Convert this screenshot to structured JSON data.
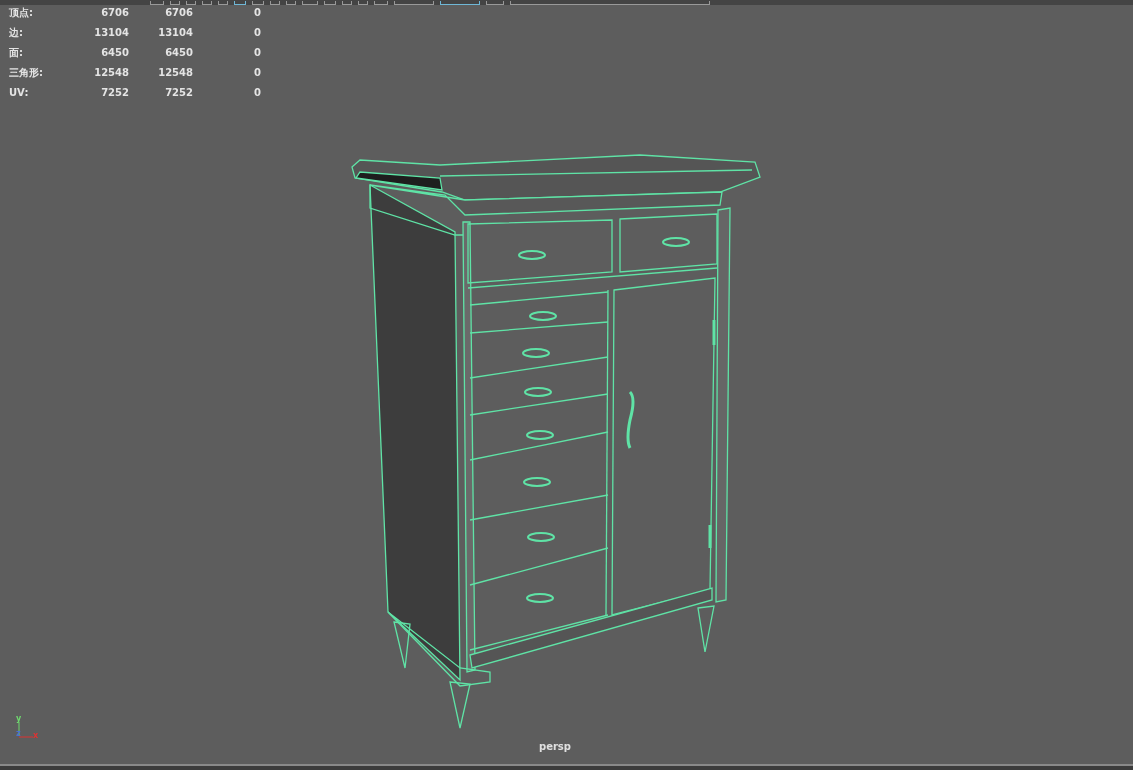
{
  "stats": [
    {
      "label": "顶点:",
      "values": [
        "6706",
        "6706",
        "0"
      ]
    },
    {
      "label": "边:",
      "values": [
        "13104",
        "13104",
        "0"
      ]
    },
    {
      "label": "面:",
      "values": [
        "6450",
        "6450",
        "0"
      ]
    },
    {
      "label": "三角形:",
      "values": [
        "12548",
        "12548",
        "0"
      ]
    },
    {
      "label": "UV:",
      "values": [
        "7252",
        "7252",
        "0"
      ]
    }
  ],
  "axis": {
    "y": "y",
    "z": "z",
    "x": "x"
  },
  "camera_label": "persp"
}
